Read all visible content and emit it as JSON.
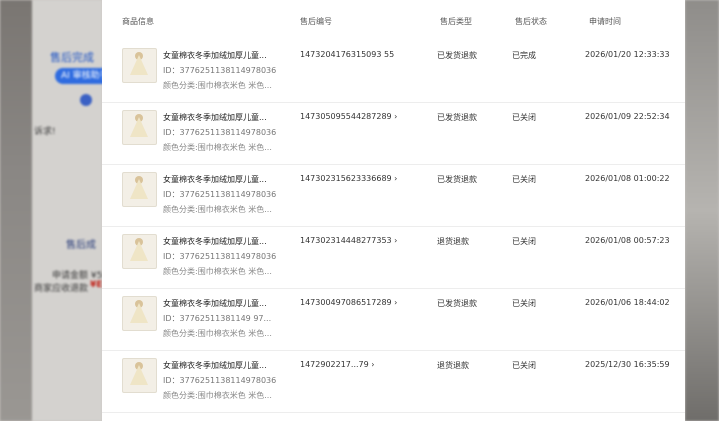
{
  "background": {
    "status_text": "售后完成",
    "ai_badge": "AI 审核助手",
    "complaint_text": "诉求!",
    "link_text": "售后成",
    "apply_amount": "申请金额 ¥59",
    "buyer_claim": "商家应收退款",
    "claim_value": "¥E"
  },
  "table": {
    "headers": [
      "商品信息",
      "售后编号",
      "售后类型",
      "售后状态",
      "申请时间"
    ],
    "rows": [
      {
        "product_name": "女童棉衣冬季加绒加厚儿童...",
        "product_id": "ID：3776251138114978036",
        "spec": "颜色分类:围巾棉衣米色 米色...",
        "after_sale_no": "1473204176315093 55",
        "type": "已发货退款",
        "status": "已完成",
        "time": "2026/01/20 12:33:33"
      },
      {
        "product_name": "女童棉衣冬季加绒加厚儿童...",
        "product_id": "ID：3776251138114978036",
        "spec": "颜色分类:围巾棉衣米色 米色...",
        "after_sale_no": "147305095544287289 ›",
        "type": "已发货退款",
        "status": "已关闭",
        "time": "2026/01/09 22:52:34"
      },
      {
        "product_name": "女童棉衣冬季加绒加厚儿童...",
        "product_id": "ID：3776251138114978036",
        "spec": "颜色分类:围巾棉衣米色 米色...",
        "after_sale_no": "147302315623336689 ›",
        "type": "已发货退款",
        "status": "已关闭",
        "time": "2026/01/08 01:00:22"
      },
      {
        "product_name": "女童棉衣冬季加绒加厚儿童...",
        "product_id": "ID：3776251138114978036",
        "spec": "颜色分类:围巾棉衣米色 米色...",
        "after_sale_no": "147302314448277353 ›",
        "type": "退货退款",
        "status": "已关闭",
        "time": "2026/01/08 00:57:23"
      },
      {
        "product_name": "女童棉衣冬季加绒加厚儿童...",
        "product_id": "ID：37762511381149 97...",
        "spec": "颜色分类:围巾棉衣米色 米色...",
        "after_sale_no": "147300497086517289 ›",
        "type": "已发货退款",
        "status": "已关闭",
        "time": "2026/01/06 18:44:02"
      },
      {
        "product_name": "女童棉衣冬季加绒加厚儿童...",
        "product_id": "ID：3776251138114978036",
        "spec": "颜色分类:围巾棉衣米色 米色...",
        "after_sale_no": "1472902217...79 ›",
        "type": "退货退款",
        "status": "已关闭",
        "time": "2025/12/30 16:35:59"
      }
    ]
  }
}
